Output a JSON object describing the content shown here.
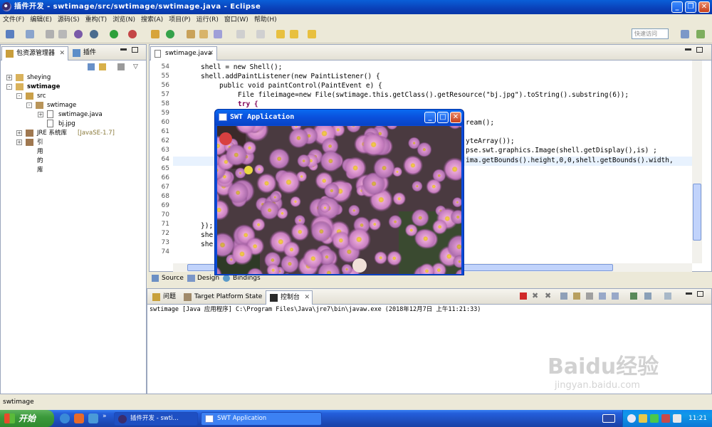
{
  "window": {
    "title": "插件开发 - swtimage/src/swtimage/swtimage.java - Eclipse"
  },
  "menu": [
    "文件(F)",
    "编辑(E)",
    "源码(S)",
    "重构(T)",
    "浏览(N)",
    "搜索(A)",
    "项目(P)",
    "运行(R)",
    "窗口(W)",
    "帮助(H)"
  ],
  "toolbar": {
    "quick_access": "快速访问"
  },
  "left_panel": {
    "tabs": [
      "包资源管理器",
      "插件"
    ],
    "tree": [
      {
        "label": "sheying",
        "level": 0,
        "expander": "+"
      },
      {
        "label": "swtimage",
        "level": 0,
        "expander": "-"
      },
      {
        "label": "src",
        "level": 1,
        "expander": "-"
      },
      {
        "label": "swtimage",
        "level": 2,
        "expander": "-"
      },
      {
        "label": "swtimage.java",
        "level": 3,
        "expander": "+"
      },
      {
        "label": "bj.jpg",
        "level": 3,
        "expander": ""
      },
      {
        "label": "JRE 系统库",
        "suffix": "[JavaSE-1.7]",
        "level": 1,
        "expander": "+"
      },
      {
        "label": "引用的库",
        "level": 1,
        "expander": "+"
      }
    ]
  },
  "editor": {
    "tab": "swtimage.java",
    "line_numbers": [
      "54",
      "55",
      "56",
      "57",
      "58",
      "59",
      "60",
      "61",
      "62",
      "63",
      "64",
      "65",
      "66",
      "67",
      "68",
      "69",
      "70",
      "71",
      "72",
      "73",
      "74"
    ],
    "lines": {
      "l54": "shell = new Shell();",
      "l55": "shell.addPaintListener(new PaintListener() {",
      "l56": "public void paintControl(PaintEvent e) {",
      "l57": "File fileimage=new File(swtimage.this.getClass().getResource(\"bj.jpg\").toString().substring(6));",
      "l58": "try {",
      "l60": "ream();",
      "l62": "yteArray());",
      "l63": "pse.swt.graphics.Image(shell.getDisplay(),is) ;",
      "l64": "ima.getBounds().height,0,0,shell.getBounds().width,",
      "l71": "});",
      "l72": "she",
      "l73": "she"
    }
  },
  "editor_bottom_tabs": [
    "Source",
    "Design",
    "Bindings"
  ],
  "console": {
    "tabs": [
      "问题",
      "Target Platform State",
      "控制台"
    ],
    "text": "swtimage [Java 应用程序] C:\\Program Files\\Java\\jre7\\bin\\javaw.exe (2018年12月7日 上午11:21:33)"
  },
  "status": {
    "text": "swtimage"
  },
  "swt_window": {
    "title": "SWT Application"
  },
  "taskbar": {
    "start": "开始",
    "tasks": [
      "插件开发 - swti...",
      "SWT Application"
    ],
    "clock": "11:21"
  },
  "watermark": {
    "text": "Baidu经验",
    "sub": "jingyan.baidu.com"
  },
  "colors": {
    "keyword": "#7f0055",
    "string": "#2a00ff",
    "titlebar": "#0a50dc",
    "highlight": "#e8f2fe"
  }
}
